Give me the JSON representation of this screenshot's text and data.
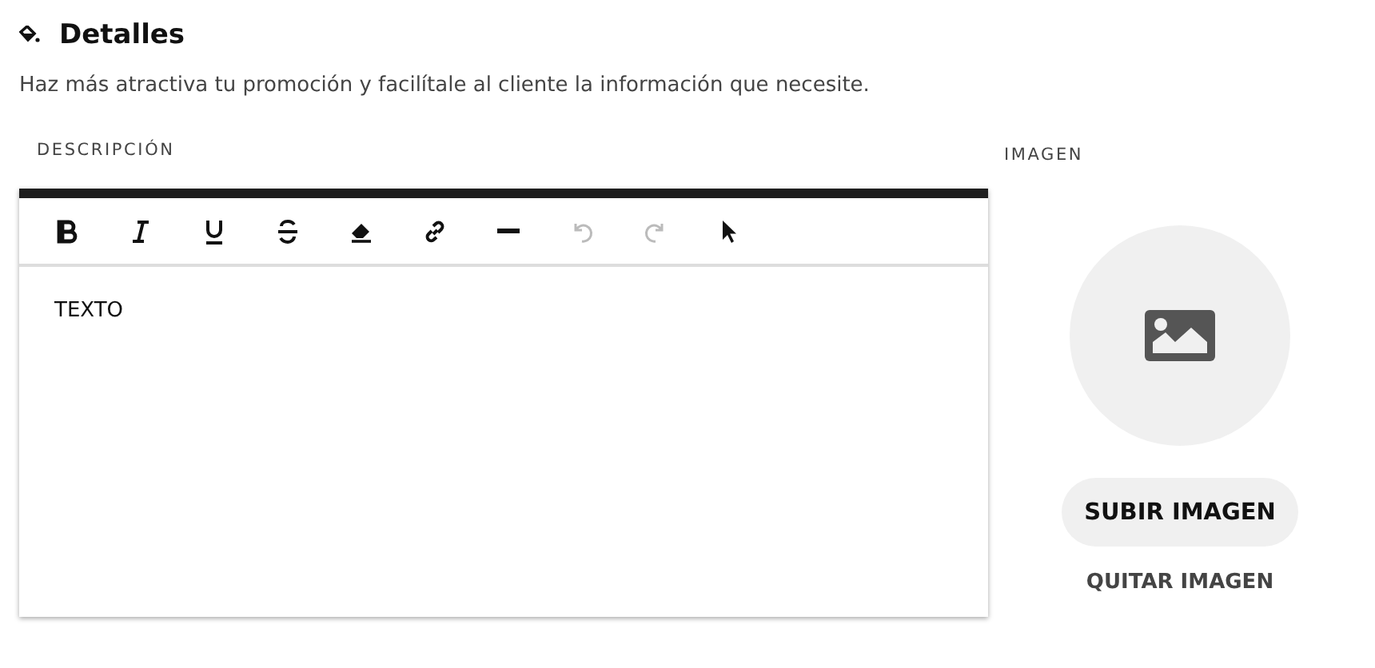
{
  "section": {
    "title": "Detalles",
    "description": "Haz más atractiva tu promoción y facilítale al cliente la información que necesite."
  },
  "editor": {
    "label": "DESCRIPCIÓN",
    "content": "TEXTO",
    "toolbar": [
      {
        "kind": "bold",
        "disabled": false
      },
      {
        "kind": "italic",
        "disabled": false
      },
      {
        "kind": "underline",
        "disabled": false
      },
      {
        "kind": "strikethrough",
        "disabled": false
      },
      {
        "kind": "eraser",
        "disabled": false
      },
      {
        "kind": "link",
        "disabled": false
      },
      {
        "kind": "rule",
        "disabled": false
      },
      {
        "kind": "undo",
        "disabled": true
      },
      {
        "kind": "redo",
        "disabled": true
      },
      {
        "kind": "pointer",
        "disabled": false
      }
    ]
  },
  "image": {
    "label": "IMAGEN",
    "upload_button": "SUBIR IMAGEN",
    "remove_button": "QUITAR IMAGEN"
  }
}
